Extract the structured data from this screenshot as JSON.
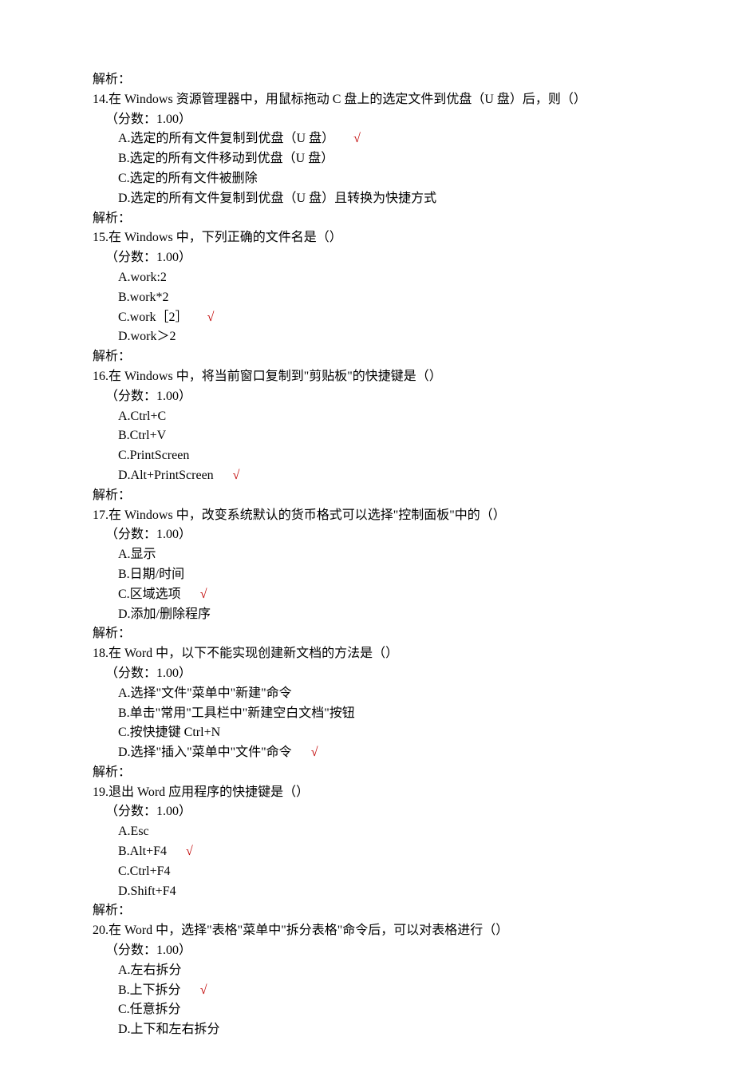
{
  "check_mark": "√",
  "lines": [
    {
      "text": "解析："
    },
    {
      "text": "14.在 Windows 资源管理器中，用鼠标拖动 C 盘上的选定文件到优盘（U 盘）后，则（）"
    },
    {
      "text": "（分数：1.00）",
      "indent": 1
    },
    {
      "text": "A.选定的所有文件复制到优盘（U 盘）",
      "indent": 2,
      "correct": true
    },
    {
      "text": "B.选定的所有文件移动到优盘（U 盘）",
      "indent": 2
    },
    {
      "text": "C.选定的所有文件被删除",
      "indent": 2
    },
    {
      "text": "D.选定的所有文件复制到优盘（U 盘）且转换为快捷方式",
      "indent": 2
    },
    {
      "text": "解析："
    },
    {
      "text": "15.在 Windows 中，下列正确的文件名是（）"
    },
    {
      "text": "（分数：1.00）",
      "indent": 1
    },
    {
      "text": "A.work:2",
      "indent": 2
    },
    {
      "text": "B.work*2",
      "indent": 2
    },
    {
      "text": "C.work［2］",
      "indent": 2,
      "correct": true
    },
    {
      "text": "D.work＞2",
      "indent": 2
    },
    {
      "text": "解析："
    },
    {
      "text": "16.在 Windows 中，将当前窗口复制到\"剪贴板\"的快捷键是（）"
    },
    {
      "text": "（分数：1.00）",
      "indent": 1
    },
    {
      "text": "A.Ctrl+C",
      "indent": 2
    },
    {
      "text": "B.Ctrl+V",
      "indent": 2
    },
    {
      "text": "C.PrintScreen",
      "indent": 2
    },
    {
      "text": "D.Alt+PrintScreen",
      "indent": 2,
      "correct": true
    },
    {
      "text": "解析："
    },
    {
      "text": "17.在 Windows 中，改变系统默认的货币格式可以选择\"控制面板\"中的（）"
    },
    {
      "text": "（分数：1.00）",
      "indent": 1
    },
    {
      "text": "A.显示",
      "indent": 2
    },
    {
      "text": "B.日期/时间",
      "indent": 2
    },
    {
      "text": "C.区域选项",
      "indent": 2,
      "correct": true
    },
    {
      "text": "D.添加/删除程序",
      "indent": 2
    },
    {
      "text": "解析："
    },
    {
      "text": "18.在 Word 中，以下不能实现创建新文档的方法是（）"
    },
    {
      "text": "（分数：1.00）",
      "indent": 1
    },
    {
      "text": "A.选择\"文件\"菜单中\"新建\"命令",
      "indent": 2
    },
    {
      "text": "B.单击\"常用\"工具栏中\"新建空白文档\"按钮",
      "indent": 2
    },
    {
      "text": "C.按快捷键 Ctrl+N",
      "indent": 2
    },
    {
      "text": "D.选择\"插入\"菜单中\"文件\"命令",
      "indent": 2,
      "correct": true
    },
    {
      "text": "解析："
    },
    {
      "text": "19.退出 Word 应用程序的快捷键是（）"
    },
    {
      "text": "（分数：1.00）",
      "indent": 1
    },
    {
      "text": "A.Esc",
      "indent": 2
    },
    {
      "text": "B.Alt+F4",
      "indent": 2,
      "correct": true
    },
    {
      "text": "C.Ctrl+F4",
      "indent": 2
    },
    {
      "text": "D.Shift+F4",
      "indent": 2
    },
    {
      "text": "解析："
    },
    {
      "text": "20.在 Word 中，选择\"表格\"菜单中\"拆分表格\"命令后，可以对表格进行（）"
    },
    {
      "text": "（分数：1.00）",
      "indent": 1
    },
    {
      "text": "A.左右拆分",
      "indent": 2
    },
    {
      "text": "B.上下拆分",
      "indent": 2,
      "correct": true
    },
    {
      "text": "C.任意拆分",
      "indent": 2
    },
    {
      "text": "D.上下和左右拆分",
      "indent": 2
    }
  ]
}
